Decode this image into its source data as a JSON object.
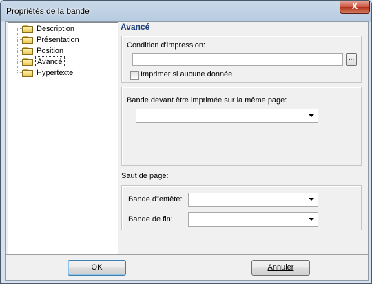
{
  "window": {
    "title": "Propriétés de la bande",
    "close_glyph": "X"
  },
  "tree": {
    "items": [
      {
        "label": "Description",
        "selected": false
      },
      {
        "label": "Présentation",
        "selected": false
      },
      {
        "label": "Position",
        "selected": false
      },
      {
        "label": "Avancé",
        "selected": true
      },
      {
        "label": "Hypertexte",
        "selected": false
      }
    ]
  },
  "panel": {
    "header": "Avancé",
    "print_condition": {
      "label": "Condition d'impression:",
      "value": "",
      "browse_label": "..."
    },
    "print_if_no_data": {
      "label": "Imprimer si aucune donnée",
      "checked": false
    },
    "same_page_band": {
      "label": "Bande devant être imprimée sur la même page:",
      "value": ""
    },
    "page_break": {
      "label": "Saut de page:",
      "header_band": {
        "label": "Bande d\"entête:",
        "value": ""
      },
      "footer_band": {
        "label": "Bande de fin:",
        "value": ""
      }
    }
  },
  "buttons": {
    "ok": "OK",
    "cancel": "Annuler"
  }
}
